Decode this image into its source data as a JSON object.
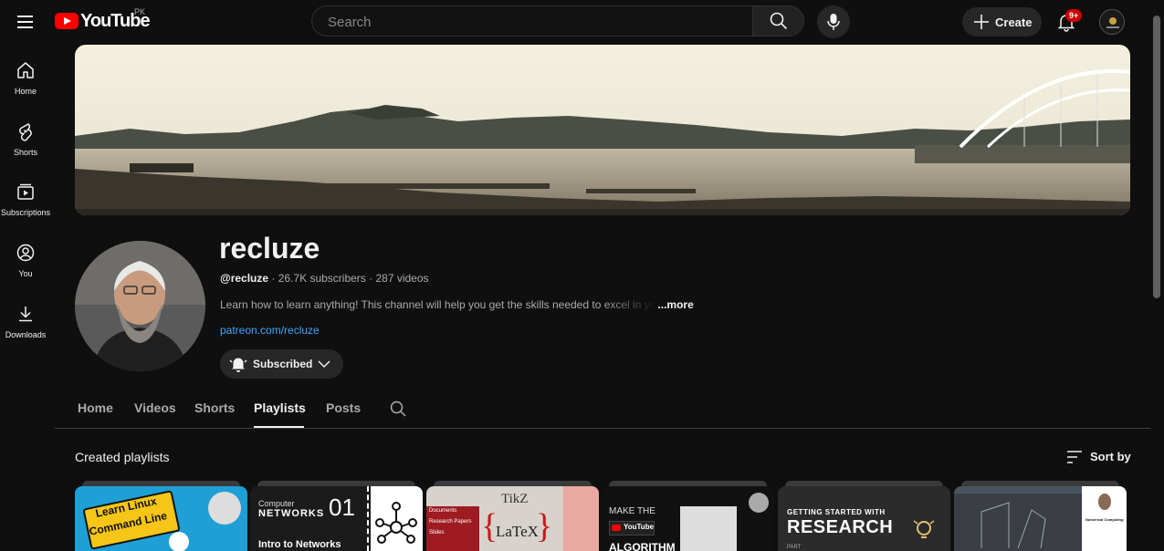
{
  "header": {
    "logo_text": "YouTube",
    "country_code": "PK",
    "search_placeholder": "Search",
    "create_label": "Create",
    "notification_count": "9+"
  },
  "sidebar": {
    "items": [
      {
        "label": "Home",
        "icon": "home-icon"
      },
      {
        "label": "Shorts",
        "icon": "shorts-icon"
      },
      {
        "label": "Subscriptions",
        "icon": "subscriptions-icon"
      },
      {
        "label": "You",
        "icon": "you-icon"
      },
      {
        "label": "Downloads",
        "icon": "downloads-icon"
      }
    ]
  },
  "channel": {
    "name": "recluze",
    "handle": "@recluze",
    "subscribers": "26.7K subscribers",
    "videos": "287 videos",
    "separator": "·",
    "description": "Learn how to learn anything! This channel will help you get the skills needed to excel in yo",
    "more_label": "...more",
    "link": "patreon.com/recluze",
    "subscribe_label": "Subscribed"
  },
  "tabs": [
    {
      "label": "Home",
      "active": false
    },
    {
      "label": "Videos",
      "active": false
    },
    {
      "label": "Shorts",
      "active": false
    },
    {
      "label": "Playlists",
      "active": true
    },
    {
      "label": "Posts",
      "active": false
    }
  ],
  "section": {
    "title": "Created playlists",
    "sort_label": "Sort by"
  },
  "playlists": [
    {
      "thumb_text_1": "Learn Linux",
      "thumb_text_2": "Command Line",
      "bg": "#1e9fd6"
    },
    {
      "thumb_text_1": "Computer",
      "thumb_text_2": "NETWORKS",
      "thumb_text_3": "01",
      "thumb_text_4": "Intro to Networks",
      "bg": "#1b1b1b"
    },
    {
      "thumb_text_1": "Documents",
      "thumb_text_2": "Research Papers",
      "thumb_text_3": "Slides",
      "thumb_text_4": "TikZ",
      "thumb_text_5": "LaTeX",
      "bg": "#d8d2cc"
    },
    {
      "thumb_text_1": "MAKE THE",
      "thumb_text_2": "YouTube",
      "thumb_text_3": "ALGORITHM",
      "bg": "#111111"
    },
    {
      "thumb_text_1": "GETTING STARTED WITH",
      "thumb_text_2": "RESEARCH",
      "thumb_text_3": "PART",
      "bg": "#2b2b2b"
    },
    {
      "thumb_text_1": "Numerical Computing",
      "bg": "#3b3f45"
    }
  ],
  "colors": {
    "background": "#0f0f0f",
    "accent_red": "#ff0000",
    "link_blue": "#3ea6ff"
  }
}
